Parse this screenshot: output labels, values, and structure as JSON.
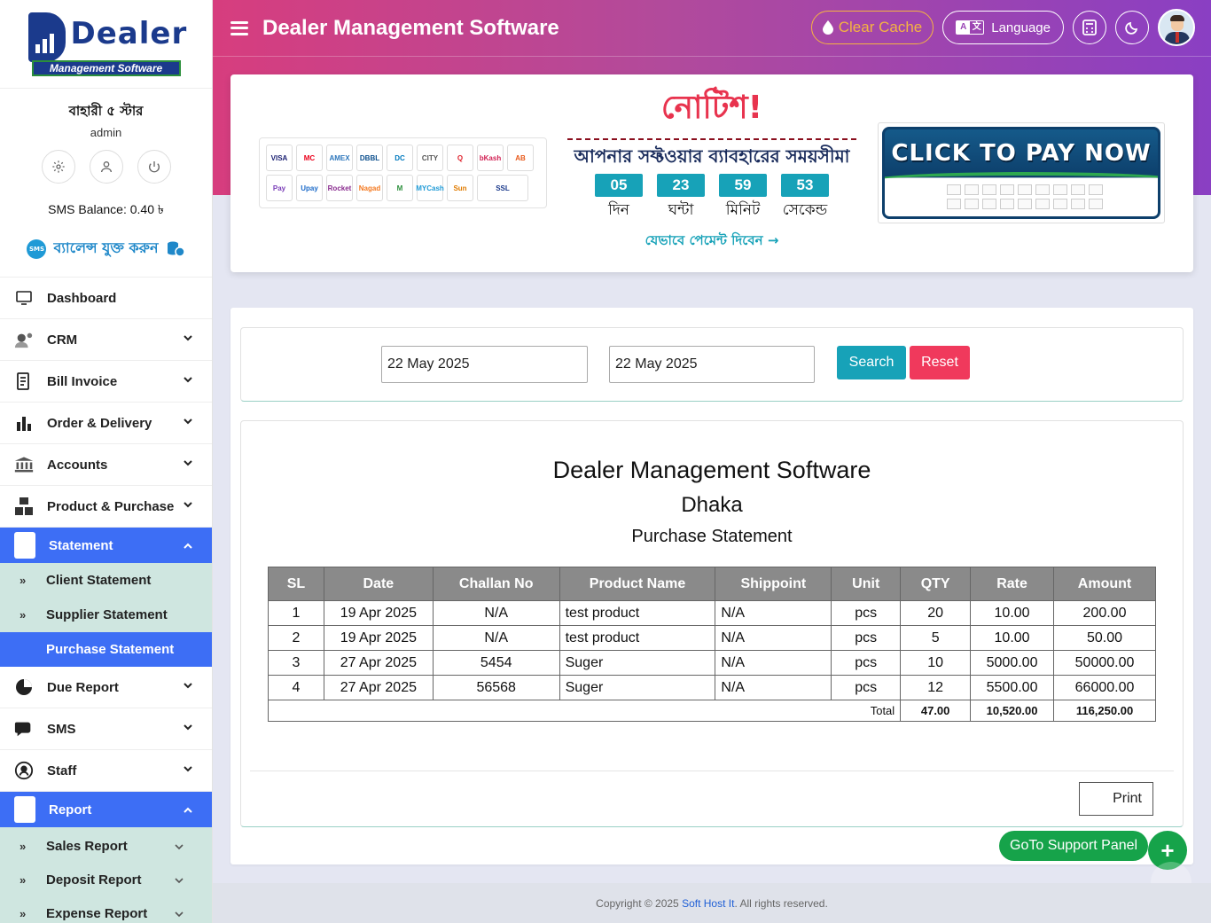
{
  "brand": {
    "logo_word": "Dealer",
    "logo_sub": "Management Software"
  },
  "profile": {
    "shop_name": "বাহারী ৫ স্টার",
    "role": "admin",
    "sms_balance": "SMS Balance: 0.40 ৳",
    "add_balance": "ব্যালেন্স যুক্ত করুন",
    "sms_badge": "SMS"
  },
  "menu": [
    {
      "label": "Dashboard"
    },
    {
      "label": "CRM"
    },
    {
      "label": "Bill Invoice"
    },
    {
      "label": "Order & Delivery"
    },
    {
      "label": "Accounts"
    },
    {
      "label": "Product & Purchase"
    },
    {
      "label": "Statement"
    },
    {
      "label": "Due Report"
    },
    {
      "label": "SMS"
    },
    {
      "label": "Staff"
    },
    {
      "label": "Report"
    }
  ],
  "statement_sub": [
    "Client Statement",
    "Supplier Statement",
    "Purchase Statement"
  ],
  "report_sub": [
    "Sales Report",
    "Deposit Report",
    "Expense Report"
  ],
  "header": {
    "title": "Dealer Management Software",
    "clear_cache": "Clear Cache",
    "language": "Language",
    "lang_icon_a": "A",
    "lang_icon_b": "文"
  },
  "notice": {
    "title": "নোটিশ!",
    "subtitle": "আপনার সফ্টওয়ার ব্যাবহারের সময়সীমা",
    "countdown": [
      {
        "value": "05",
        "label": "দিন"
      },
      {
        "value": "23",
        "label": "ঘন্টা"
      },
      {
        "value": "59",
        "label": "মিনিট"
      },
      {
        "value": "53",
        "label": "সেকেন্ড"
      }
    ],
    "how_to_pay": "যেভাবে পেমেন্ট দিবেন →",
    "click_to_pay": "CLICK TO PAY NOW",
    "pay_logos": [
      "VISA",
      "MC",
      "AMEX",
      "DBBL",
      "DC",
      "CITY",
      "Q",
      "bKash",
      "AB",
      "Pay",
      "Upay",
      "Rocket",
      "Nagad",
      "M",
      "MYCash",
      "Sun",
      "SSL"
    ]
  },
  "filter": {
    "from_date": "22 May 2025",
    "to_date": "22 May 2025",
    "search": "Search",
    "reset": "Reset"
  },
  "report": {
    "company": "Dealer Management Software",
    "city": "Dhaka",
    "title": "Purchase Statement",
    "columns": [
      "SL",
      "Date",
      "Challan No",
      "Product Name",
      "Shippoint",
      "Unit",
      "QTY",
      "Rate",
      "Amount"
    ],
    "rows": [
      [
        "1",
        "19 Apr 2025",
        "N/A",
        "test product",
        "N/A",
        "pcs",
        "20",
        "10.00",
        "200.00"
      ],
      [
        "2",
        "19 Apr 2025",
        "N/A",
        "test product",
        "N/A",
        "pcs",
        "5",
        "10.00",
        "50.00"
      ],
      [
        "3",
        "27 Apr 2025",
        "5454",
        "Suger",
        "N/A",
        "pcs",
        "10",
        "5000.00",
        "50000.00"
      ],
      [
        "4",
        "27 Apr 2025",
        "56568",
        "Suger",
        "N/A",
        "pcs",
        "12",
        "5500.00",
        "66000.00"
      ]
    ],
    "total_label": "Total",
    "total_qty": "47.00",
    "total_rate": "10,520.00",
    "total_amount": "116,250.00",
    "print": "Print"
  },
  "support_panel": "GoTo Support Panel",
  "fab_plus": "+",
  "footer": {
    "text": "Copyright © 2025 ",
    "link": "Soft Host It",
    "suffix": ". All rights reserved."
  },
  "colors": {
    "accent": "#3d6ef5",
    "teal": "#17a2b8",
    "danger": "#f0395c",
    "success": "#16a34a"
  }
}
